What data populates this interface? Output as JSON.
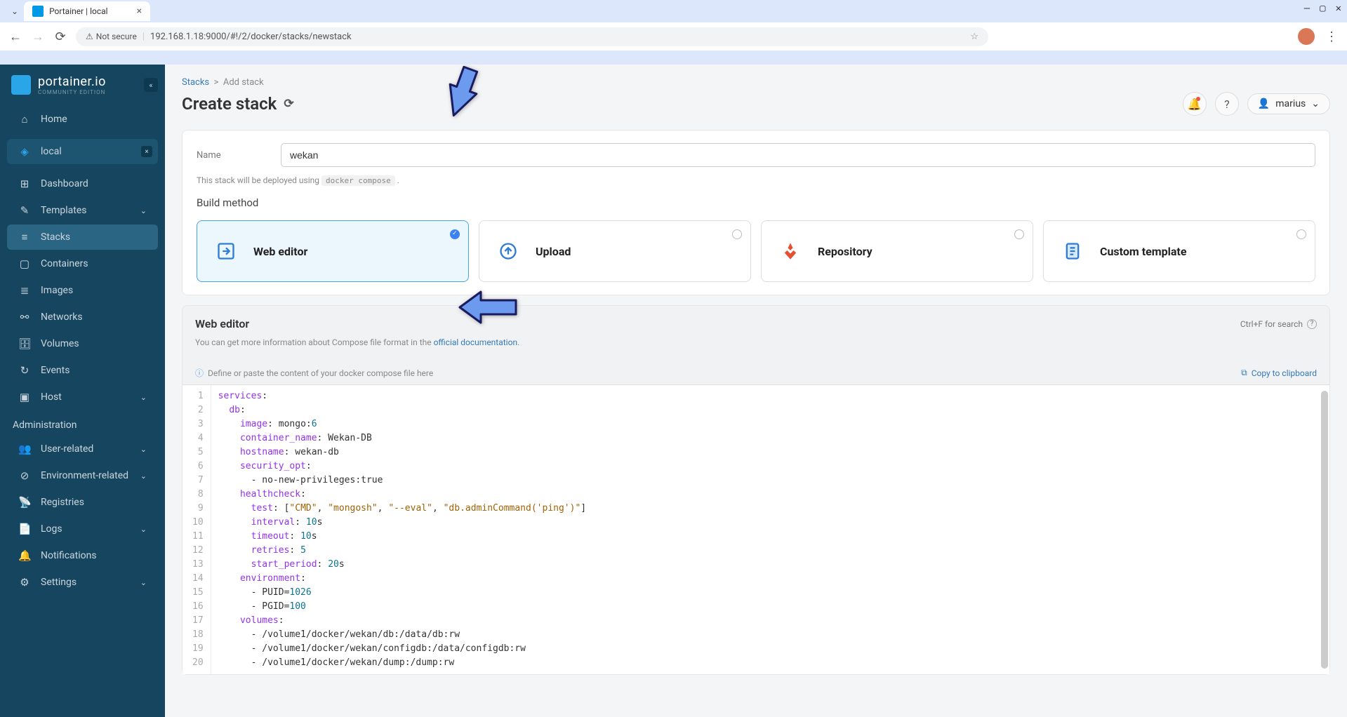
{
  "browser": {
    "tab_title": "Portainer | local",
    "url_security": "Not secure",
    "url": "192.168.1.18:9000/#!/2/docker/stacks/newstack"
  },
  "sidebar": {
    "logo_title": "portainer.io",
    "logo_sub": "COMMUNITY EDITION",
    "home": "Home",
    "env_name": "local",
    "items": [
      {
        "icon": "⊞",
        "label": "Dashboard"
      },
      {
        "icon": "✎",
        "label": "Templates",
        "chevron": true
      },
      {
        "icon": "≡",
        "label": "Stacks",
        "active": true
      },
      {
        "icon": "▢",
        "label": "Containers"
      },
      {
        "icon": "≣",
        "label": "Images"
      },
      {
        "icon": "⚯",
        "label": "Networks"
      },
      {
        "icon": "🗄",
        "label": "Volumes"
      },
      {
        "icon": "↻",
        "label": "Events"
      },
      {
        "icon": "▣",
        "label": "Host",
        "chevron": true
      }
    ],
    "admin_label": "Administration",
    "admin_items": [
      {
        "icon": "👥",
        "label": "User-related",
        "chevron": true
      },
      {
        "icon": "⊘",
        "label": "Environment-related",
        "chevron": true
      },
      {
        "icon": "📡",
        "label": "Registries"
      },
      {
        "icon": "📄",
        "label": "Logs",
        "chevron": true
      },
      {
        "icon": "🔔",
        "label": "Notifications"
      },
      {
        "icon": "⚙",
        "label": "Settings",
        "chevron": true
      }
    ]
  },
  "breadcrumb": {
    "parent": "Stacks",
    "current": "Add stack"
  },
  "page": {
    "title": "Create stack",
    "user": "marius"
  },
  "form": {
    "name_label": "Name",
    "name_value": "wekan",
    "help_prefix": "This stack will be deployed using ",
    "help_code": "docker compose",
    "build_label": "Build method",
    "options": [
      {
        "label": "Web editor",
        "selected": true
      },
      {
        "label": "Upload"
      },
      {
        "label": "Repository"
      },
      {
        "label": "Custom template"
      }
    ]
  },
  "editor": {
    "title": "Web editor",
    "hint": "Ctrl+F for search",
    "desc_prefix": "You can get more information about Compose file format in the ",
    "desc_link": "official documentation",
    "placeholder": "Define or paste the content of your docker compose file here",
    "copy": "Copy to clipboard",
    "lines": [
      [
        {
          "t": "services",
          "c": "k"
        },
        {
          "t": ":",
          "c": "p"
        }
      ],
      [
        {
          "t": "  ",
          "c": "p"
        },
        {
          "t": "db",
          "c": "k"
        },
        {
          "t": ":",
          "c": "p"
        }
      ],
      [
        {
          "t": "    ",
          "c": "p"
        },
        {
          "t": "image",
          "c": "k"
        },
        {
          "t": ": mongo:",
          "c": "p"
        },
        {
          "t": "6",
          "c": "n"
        }
      ],
      [
        {
          "t": "    ",
          "c": "p"
        },
        {
          "t": "container_name",
          "c": "k"
        },
        {
          "t": ": Wekan-DB",
          "c": "p"
        }
      ],
      [
        {
          "t": "    ",
          "c": "p"
        },
        {
          "t": "hostname",
          "c": "k"
        },
        {
          "t": ": wekan-db",
          "c": "p"
        }
      ],
      [
        {
          "t": "    ",
          "c": "p"
        },
        {
          "t": "security_opt",
          "c": "k"
        },
        {
          "t": ":",
          "c": "p"
        }
      ],
      [
        {
          "t": "      - no-new-privileges:true",
          "c": "p"
        }
      ],
      [
        {
          "t": "    ",
          "c": "p"
        },
        {
          "t": "healthcheck",
          "c": "k"
        },
        {
          "t": ":",
          "c": "p"
        }
      ],
      [
        {
          "t": "      ",
          "c": "p"
        },
        {
          "t": "test",
          "c": "k"
        },
        {
          "t": ": [",
          "c": "p"
        },
        {
          "t": "\"CMD\"",
          "c": "s"
        },
        {
          "t": ", ",
          "c": "p"
        },
        {
          "t": "\"mongosh\"",
          "c": "s"
        },
        {
          "t": ", ",
          "c": "p"
        },
        {
          "t": "\"--eval\"",
          "c": "s"
        },
        {
          "t": ", ",
          "c": "p"
        },
        {
          "t": "\"db.adminCommand('ping')\"",
          "c": "s"
        },
        {
          "t": "]",
          "c": "p"
        }
      ],
      [
        {
          "t": "      ",
          "c": "p"
        },
        {
          "t": "interval",
          "c": "k"
        },
        {
          "t": ": ",
          "c": "p"
        },
        {
          "t": "10",
          "c": "n"
        },
        {
          "t": "s",
          "c": "p"
        }
      ],
      [
        {
          "t": "      ",
          "c": "p"
        },
        {
          "t": "timeout",
          "c": "k"
        },
        {
          "t": ": ",
          "c": "p"
        },
        {
          "t": "10",
          "c": "n"
        },
        {
          "t": "s",
          "c": "p"
        }
      ],
      [
        {
          "t": "      ",
          "c": "p"
        },
        {
          "t": "retries",
          "c": "k"
        },
        {
          "t": ": ",
          "c": "p"
        },
        {
          "t": "5",
          "c": "n"
        }
      ],
      [
        {
          "t": "      ",
          "c": "p"
        },
        {
          "t": "start_period",
          "c": "k"
        },
        {
          "t": ": ",
          "c": "p"
        },
        {
          "t": "20",
          "c": "n"
        },
        {
          "t": "s",
          "c": "p"
        }
      ],
      [
        {
          "t": "    ",
          "c": "p"
        },
        {
          "t": "environment",
          "c": "k"
        },
        {
          "t": ":",
          "c": "p"
        }
      ],
      [
        {
          "t": "      - PUID=",
          "c": "p"
        },
        {
          "t": "1026",
          "c": "n"
        }
      ],
      [
        {
          "t": "      - PGID=",
          "c": "p"
        },
        {
          "t": "100",
          "c": "n"
        }
      ],
      [
        {
          "t": "    ",
          "c": "p"
        },
        {
          "t": "volumes",
          "c": "k"
        },
        {
          "t": ":",
          "c": "p"
        }
      ],
      [
        {
          "t": "      - /volume1/docker/wekan/db:/data/db:rw",
          "c": "p"
        }
      ],
      [
        {
          "t": "      - /volume1/docker/wekan/configdb:/data/configdb:rw",
          "c": "p"
        }
      ],
      [
        {
          "t": "      - /volume1/docker/wekan/dump:/dump:rw",
          "c": "p"
        }
      ]
    ]
  }
}
